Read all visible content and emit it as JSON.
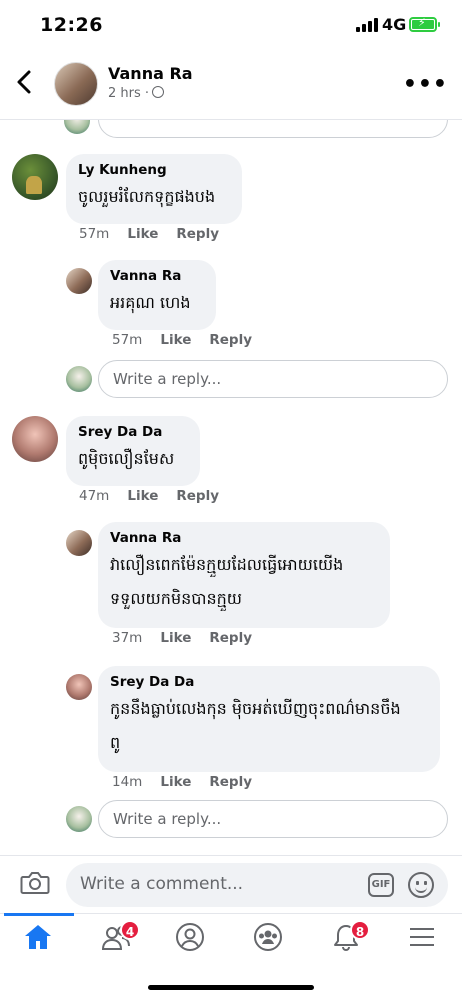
{
  "status_bar": {
    "time": "12:26",
    "network": "4G"
  },
  "post_header": {
    "name": "Vanna Ra",
    "time": "2 hrs ·"
  },
  "comments": [
    {
      "name": "Ly Kunheng",
      "text": "ចូលរួមរំលែកទុក្ខផងបង",
      "time": "57m",
      "like": "Like",
      "reply": "Reply",
      "replies": [
        {
          "name": "Vanna Ra",
          "text": "អរគុណ ហេង",
          "time": "57m",
          "like": "Like",
          "reply": "Reply"
        }
      ],
      "reply_placeholder": "Write a reply..."
    },
    {
      "name": "Srey Da Da",
      "text": "ពូម៉ិចលឿនមែស",
      "time": "47m",
      "like": "Like",
      "reply": "Reply",
      "replies": [
        {
          "name": "Vanna Ra",
          "text_line1": "វាលឿនពេកម៉ែនក្មួយដែលធ្វើអោយយើង",
          "text_line2": "ទទួលយកមិនបានក្មួយ",
          "time": "37m",
          "like": "Like",
          "reply": "Reply"
        },
        {
          "name": "Srey Da Da",
          "text_line1": "កូននឹងធ្លាប់លេងកុន ម៉ិចអត់ឃើញចុះពណ៌មានចឹង",
          "text_line2": "ពូ",
          "time": "14m",
          "like": "Like",
          "reply": "Reply"
        }
      ],
      "reply_placeholder": "Write a reply..."
    }
  ],
  "top_reply_placeholder": "Write a reply...",
  "comment_bar": {
    "placeholder": "Write a comment...",
    "gif": "GIF"
  },
  "tab_bar": {
    "friends_badge": "4",
    "notifications_badge": "8"
  },
  "colors": {
    "accent": "#1877f2",
    "badge": "#e41e3f",
    "battery": "#2ecc40"
  }
}
